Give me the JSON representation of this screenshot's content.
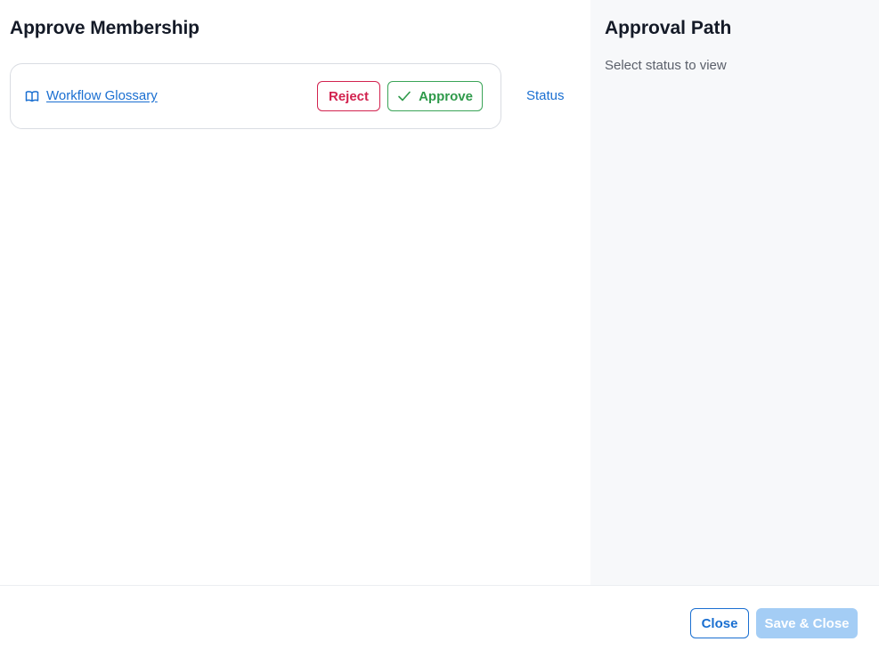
{
  "main": {
    "title": "Approve Membership",
    "item": {
      "name": "Workflow Glossary",
      "icon": "book-open-icon",
      "reject_label": "Reject",
      "approve_label": "Approve",
      "approve_icon": "check-icon"
    },
    "status_label": "Status"
  },
  "side_panel": {
    "title": "Approval Path",
    "hint": "Select status to view"
  },
  "footer": {
    "close_label": "Close",
    "save_close_label": "Save & Close",
    "save_close_disabled": true
  },
  "colors": {
    "link": "#1a6fd1",
    "reject": "#d2234f",
    "approve": "#2f9a4b",
    "save_disabled_bg": "#a4cdf5",
    "side_panel_bg": "#f7f8fa"
  }
}
